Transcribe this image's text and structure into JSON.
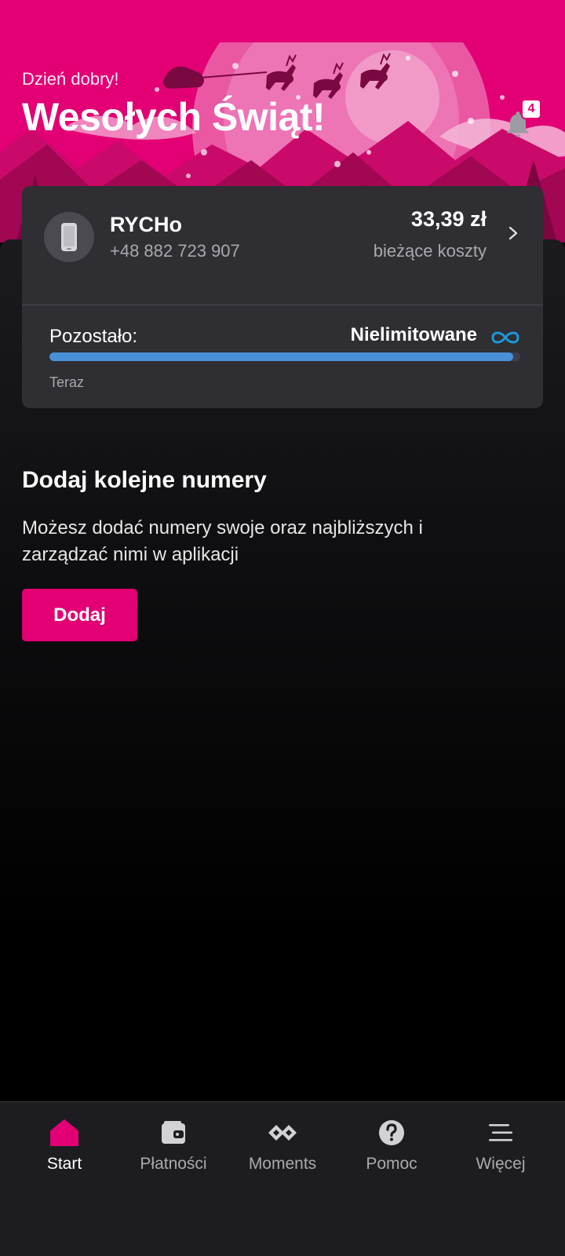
{
  "header": {
    "greeting": "Dzień dobry!",
    "title": "Wesołych Świąt!",
    "notification_count": "4",
    "bell_icon": "bell-icon"
  },
  "account_card": {
    "name": "RYCHo",
    "phone_number": "+48 882 723 907",
    "amount": "33,39 zł",
    "amount_label": "bieżące koszty",
    "remaining_label": "Pozostało:",
    "remaining_value": "Nielimitowane",
    "remaining_fraction": 0.985,
    "time_label": "Teraz",
    "avatar_icon": "phone-icon"
  },
  "add_numbers": {
    "title": "Dodaj kolejne numery",
    "description": "Możesz dodać numery swoje oraz najbliższych i zarządzać nimi w aplikacji",
    "button_label": "Dodaj"
  },
  "bottom_nav": {
    "items": [
      {
        "label": "Start",
        "icon": "home-icon",
        "active": true
      },
      {
        "label": "Płatności",
        "icon": "wallet-icon",
        "active": false
      },
      {
        "label": "Moments",
        "icon": "moments-icon",
        "active": false
      },
      {
        "label": "Pomoc",
        "icon": "help-icon",
        "active": false
      },
      {
        "label": "Więcej",
        "icon": "menu-icon",
        "active": false
      }
    ]
  },
  "colors": {
    "brand": "#e20074",
    "card": "#2e2e33",
    "progress": "#4a90d9",
    "infinity": "#1b9ad6"
  }
}
